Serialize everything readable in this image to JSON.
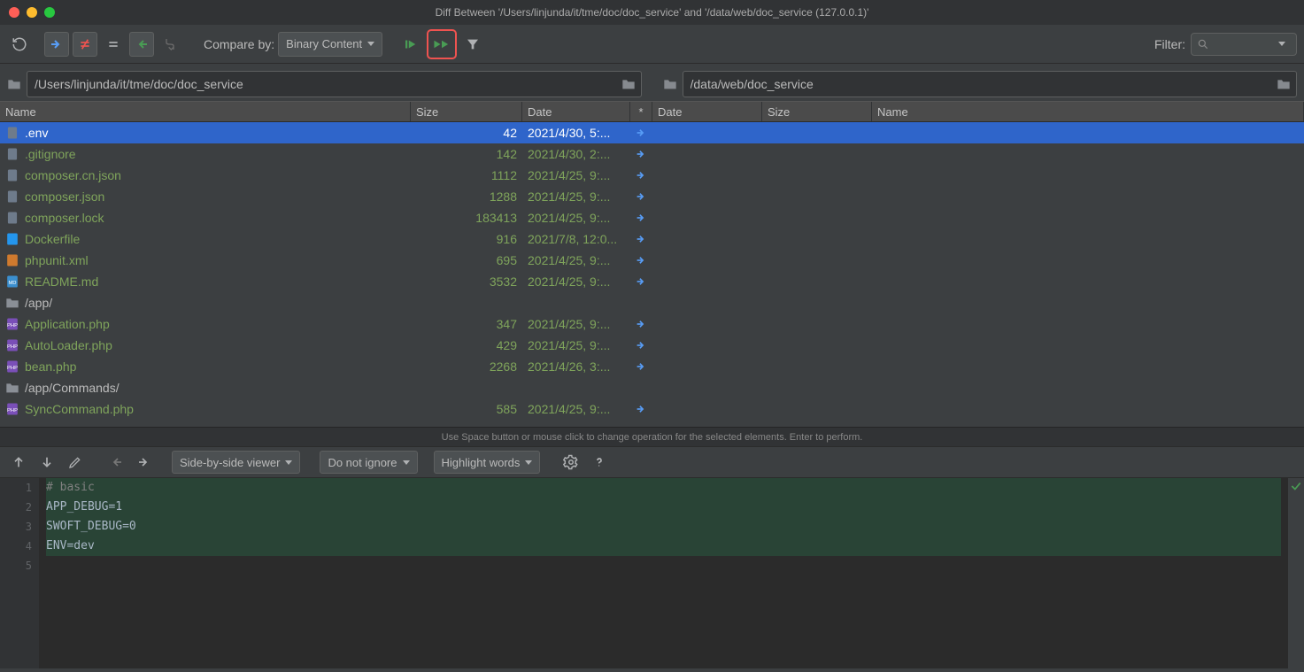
{
  "window": {
    "title": "Diff Between '/Users/linjunda/it/tme/doc/doc_service' and '/data/web/doc_service (127.0.0.1)'"
  },
  "toolbar": {
    "compare_label": "Compare by:",
    "compare_dropdown": "Binary Content",
    "filter_label": "Filter:",
    "filter_value": ""
  },
  "paths": {
    "left": "/Users/linjunda/it/tme/doc/doc_service",
    "right": "/data/web/doc_service"
  },
  "columns": {
    "name_l": "Name",
    "size_l": "Size",
    "date_l": "Date",
    "op": "*",
    "date_r": "Date",
    "size_r": "Size",
    "name_r": "Name"
  },
  "rows": [
    {
      "name": ".env",
      "size": "42",
      "date": "2021/4/30, 5:...",
      "kind": "file",
      "selected": true,
      "diff": true,
      "op": "right"
    },
    {
      "name": ".gitignore",
      "size": "142",
      "date": "2021/4/30, 2:...",
      "kind": "file-git",
      "diff": true,
      "op": "right"
    },
    {
      "name": "composer.cn.json",
      "size": "1112",
      "date": "2021/4/25, 9:...",
      "kind": "file-json",
      "diff": true,
      "op": "right"
    },
    {
      "name": "composer.json",
      "size": "1288",
      "date": "2021/4/25, 9:...",
      "kind": "file-json",
      "diff": true,
      "op": "right"
    },
    {
      "name": "composer.lock",
      "size": "183413",
      "date": "2021/4/25, 9:...",
      "kind": "file",
      "diff": true,
      "op": "right"
    },
    {
      "name": "Dockerfile",
      "size": "916",
      "date": "2021/7/8, 12:0...",
      "kind": "file-docker",
      "diff": true,
      "op": "right"
    },
    {
      "name": "phpunit.xml",
      "size": "695",
      "date": "2021/4/25, 9:...",
      "kind": "file-xml",
      "diff": true,
      "op": "right"
    },
    {
      "name": "README.md",
      "size": "3532",
      "date": "2021/4/25, 9:...",
      "kind": "file-md",
      "diff": true,
      "op": "right"
    },
    {
      "name": "/app/",
      "size": "",
      "date": "",
      "kind": "folder",
      "diff": false,
      "op": ""
    },
    {
      "name": "Application.php",
      "size": "347",
      "date": "2021/4/25, 9:...",
      "kind": "file-php",
      "diff": true,
      "op": "right",
      "indent": true
    },
    {
      "name": "AutoLoader.php",
      "size": "429",
      "date": "2021/4/25, 9:...",
      "kind": "file-php",
      "diff": true,
      "op": "right",
      "indent": true
    },
    {
      "name": "bean.php",
      "size": "2268",
      "date": "2021/4/26, 3:...",
      "kind": "file-php",
      "diff": true,
      "op": "right",
      "indent": true
    },
    {
      "name": "/app/Commands/",
      "size": "",
      "date": "",
      "kind": "folder",
      "diff": false,
      "op": ""
    },
    {
      "name": "SyncCommand.php",
      "size": "585",
      "date": "2021/4/25, 9:...",
      "kind": "file-php",
      "diff": true,
      "op": "right",
      "indent": true
    }
  ],
  "hint": "Use Space button or mouse click to change operation for the selected elements. Enter to perform.",
  "diffbar": {
    "viewer_mode": "Side-by-side viewer",
    "ignore_mode": "Do not ignore",
    "highlight_mode": "Highlight words"
  },
  "code": {
    "lines": [
      {
        "n": "1",
        "text": "# basic",
        "cls": "cm",
        "diff": true
      },
      {
        "n": "2",
        "text": "APP_DEBUG=1",
        "cls": "txt",
        "diff": true
      },
      {
        "n": "3",
        "text": "SWOFT_DEBUG=0",
        "cls": "txt",
        "diff": true
      },
      {
        "n": "4",
        "text": "ENV=dev",
        "cls": "txt",
        "diff": true
      },
      {
        "n": "5",
        "text": "",
        "cls": "txt",
        "diff": false
      }
    ]
  }
}
